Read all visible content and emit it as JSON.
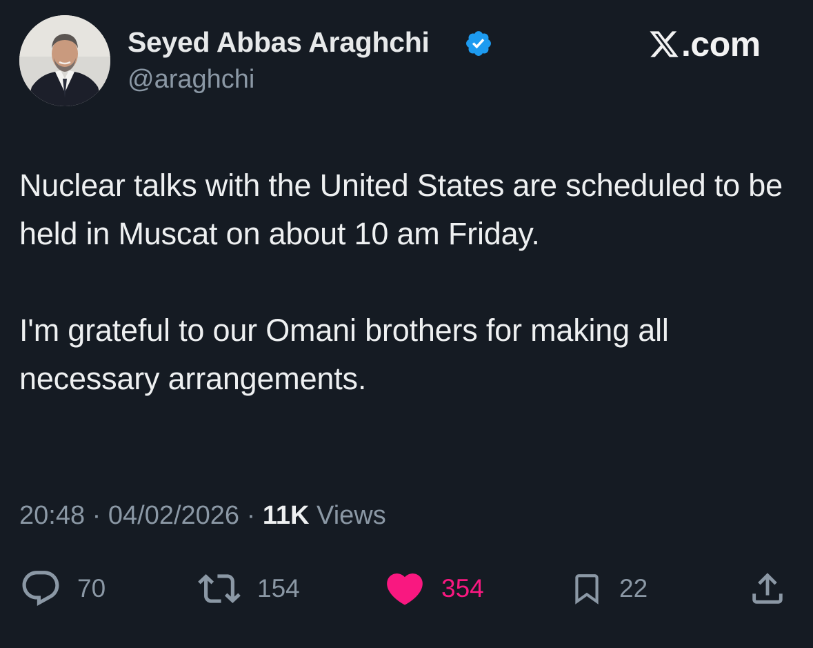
{
  "author": {
    "display_name": "Seyed Abbas Araghchi",
    "handle": "@araghchi",
    "verified": true,
    "avatar_icon": "avatar-photo"
  },
  "brand": {
    "logo_text": ".com",
    "logo_icon": "x-logo-icon"
  },
  "tweet": {
    "paragraphs": [
      "Nuclear talks with the United States are scheduled to be held in Muscat on about 10 am Friday.",
      "I'm grateful to our Omani brothers for making all necessary arrangements."
    ],
    "time": "20:48",
    "separator": "·",
    "date": "04/02/2026",
    "views_count": "11K",
    "views_label": "Views"
  },
  "actions": {
    "replies": "70",
    "retweets": "154",
    "likes": "354",
    "bookmarks": "22"
  },
  "colors": {
    "background": "#151b23",
    "text": "#e7e9ea",
    "muted": "#8b98a5",
    "like": "#f91880",
    "verified": "#1d9bf0"
  }
}
